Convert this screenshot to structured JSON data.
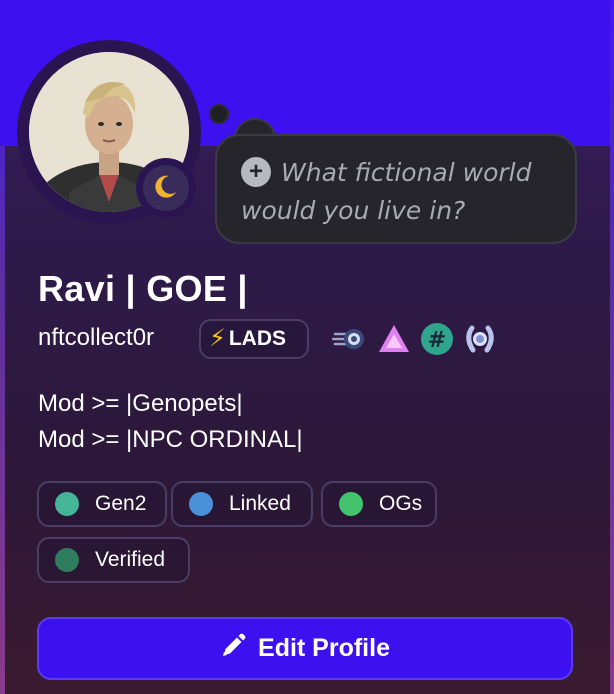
{
  "colors": {
    "banner": "#3c10ef",
    "button": "#3c10ef",
    "role_gen2": "#45b597",
    "role_linked": "#4a90d9",
    "role_ogs": "#43c36b",
    "role_verified": "#2e7d5e"
  },
  "status_bubble": {
    "add_icon": "plus-circle-icon",
    "prompt": "What fictional world would you live in?"
  },
  "profile": {
    "display_name": "Ravi | GOE |",
    "username": "nftcollect0r",
    "server_tag": {
      "icon": "lightning-bolt-icon",
      "label": "LADS"
    },
    "badges": [
      "speedometer-badge-icon",
      "triangle-badge-icon",
      "hashtag-badge-icon",
      "laurel-badge-icon"
    ],
    "status_icon": "crescent-moon-icon",
    "bio_lines": [
      "Mod >= |Genopets|",
      "Mod >= |NPC ORDINAL|"
    ]
  },
  "roles": [
    {
      "label": "Gen2"
    },
    {
      "label": "Linked"
    },
    {
      "label": "OGs"
    },
    {
      "label": "Verified"
    }
  ],
  "actions": {
    "edit_profile": "Edit Profile",
    "edit_icon": "pencil-icon"
  }
}
